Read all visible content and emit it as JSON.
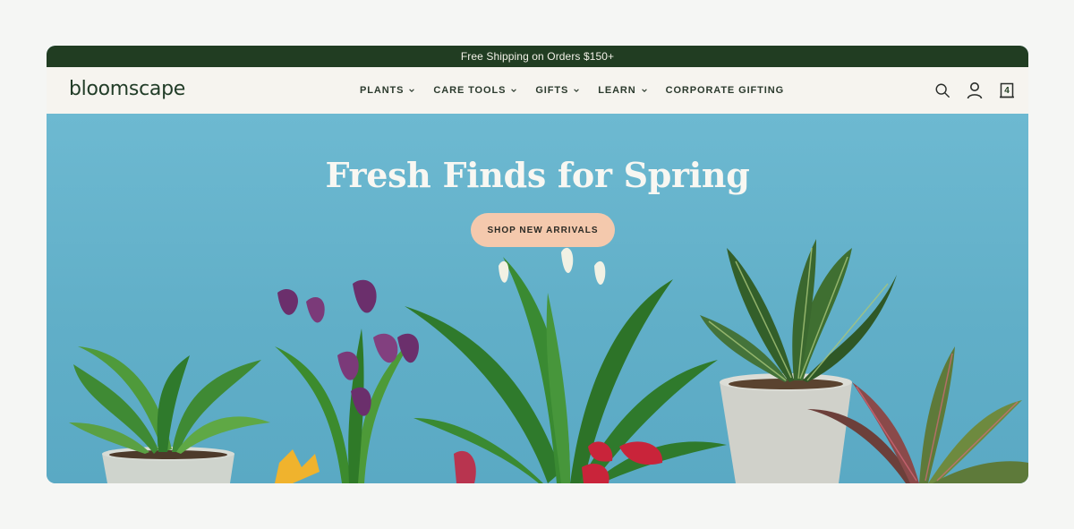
{
  "promo": {
    "text": "Free Shipping on Orders $150+"
  },
  "header": {
    "logo": "bloomscape",
    "nav": [
      {
        "label": "PLANTS",
        "has_dropdown": true
      },
      {
        "label": "CARE TOOLS",
        "has_dropdown": true
      },
      {
        "label": "GIFTS",
        "has_dropdown": true
      },
      {
        "label": "LEARN",
        "has_dropdown": true
      },
      {
        "label": "CORPORATE GIFTING",
        "has_dropdown": false
      }
    ],
    "icons": [
      "search-icon",
      "account-icon",
      "cart-icon"
    ],
    "cart_count": "4"
  },
  "hero": {
    "title": "Fresh Finds for Spring",
    "cta_label": "SHOP NEW ARRIVALS"
  },
  "colors": {
    "promo_bg": "#213d22",
    "header_bg": "#f6f4ef",
    "hero_bg": "#6ab6cf",
    "cta_bg": "#f4c9ad",
    "brand_green": "#223d28"
  }
}
